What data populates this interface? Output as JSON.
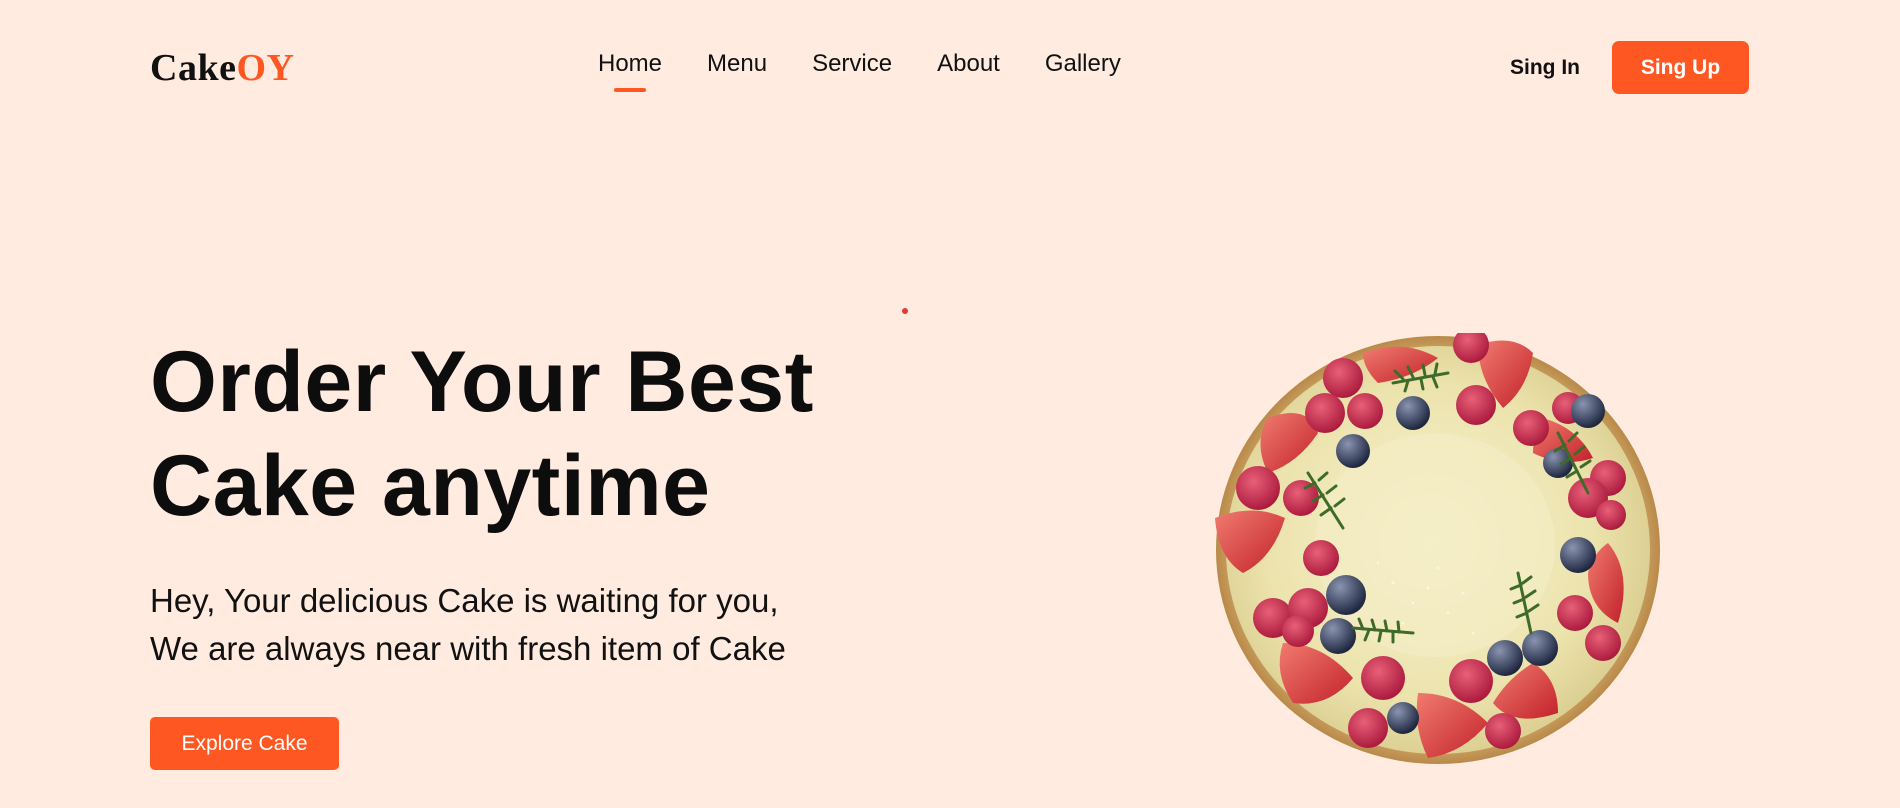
{
  "brand": {
    "name_part1": "Cake",
    "name_part2": "OY",
    "accent_color": "#ff5722"
  },
  "nav": {
    "items": [
      {
        "label": "Home",
        "active": true
      },
      {
        "label": "Menu",
        "active": false
      },
      {
        "label": "Service",
        "active": false
      },
      {
        "label": "About",
        "active": false
      },
      {
        "label": "Gallery",
        "active": false
      }
    ]
  },
  "auth": {
    "signin_label": "Sing In",
    "signup_label": "Sing Up"
  },
  "hero": {
    "title_line1": "Order Your Best",
    "title_line2": "Cake anytime",
    "subtitle_line1": "Hey, Your delicious Cake is waiting for you,",
    "subtitle_line2": "We are always near with fresh item of Cake",
    "cta_label": "Explore Cake",
    "image_icon": "berry-cake-image"
  },
  "colors": {
    "background": "#ffebe0",
    "accent": "#ff5722",
    "text": "#111111"
  }
}
